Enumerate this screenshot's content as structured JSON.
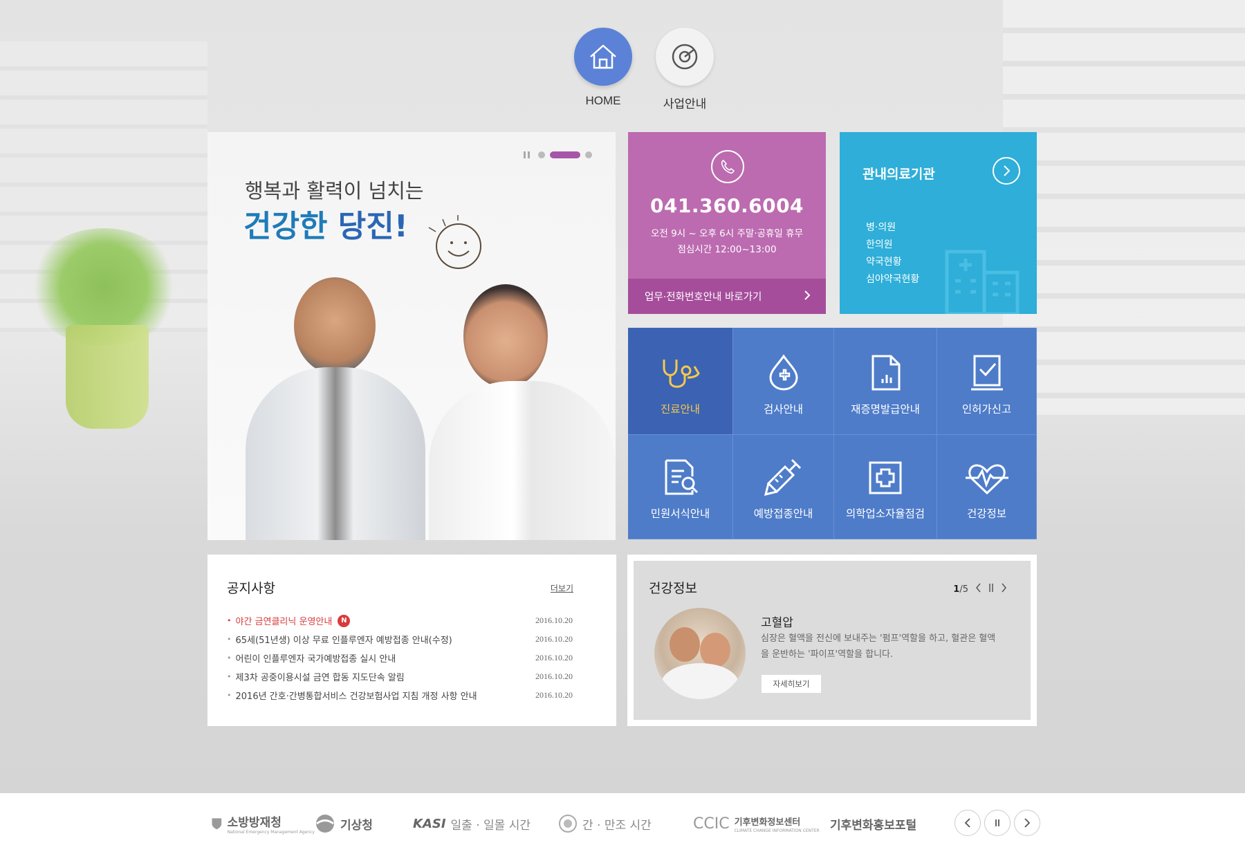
{
  "nav": {
    "home_label": "HOME",
    "business_label": "사업안내"
  },
  "hero": {
    "line1": "행복과 활력이 넘치는",
    "line2_a": "건강한",
    "line2_b": "당진!"
  },
  "phone": {
    "number": "041.360.6004",
    "hours": "오전 9시 ~ 오후 6시 주말·공휴일 휴무",
    "lunch": "점심시간 12:00~13:00",
    "link_label": "업무·전화번호안내 바로가기"
  },
  "medical": {
    "title": "관내의료기관",
    "items": [
      "병·의원",
      "한의원",
      "약국현황",
      "심야약국현황"
    ]
  },
  "services": [
    {
      "label": "진료안내",
      "icon": "stethoscope-icon"
    },
    {
      "label": "검사안내",
      "icon": "blood-drop-cross-icon"
    },
    {
      "label": "재증명발급안내",
      "icon": "document-chart-icon"
    },
    {
      "label": "인허가신고",
      "icon": "clipboard-check-icon"
    },
    {
      "label": "민원서식안내",
      "icon": "document-search-icon"
    },
    {
      "label": "예방접종안내",
      "icon": "syringe-icon"
    },
    {
      "label": "의학업소자율점검",
      "icon": "medical-box-icon"
    },
    {
      "label": "건강정보",
      "icon": "heart-pulse-icon"
    }
  ],
  "notice": {
    "title": "공지사항",
    "more_label": "더보기",
    "new_badge": "N",
    "items": [
      {
        "title": "야간 금연클리닉 운영안내",
        "date": "2016.10.20"
      },
      {
        "title": "65세(51년생) 이상 무료 인플루엔자 예방접종 안내(수정)",
        "date": "2016.10.20"
      },
      {
        "title": "어린이 인플루엔자 국가예방접종 실시 안내",
        "date": "2016.10.20"
      },
      {
        "title": "제3차 공중이용시설 금연 합동 지도단속 알림",
        "date": "2016.10.20"
      },
      {
        "title": "2016년 간호·간병통합서비스 건강보험사업 지침 개정 사항 안내",
        "date": "2016.10.20"
      }
    ]
  },
  "health": {
    "title": "건강정보",
    "page_current": "1",
    "page_total": "/5",
    "item_title": "고혈압",
    "item_desc": "심장은 혈액을 전신에 보내주는 '펌프'역할을 하고, 혈관은 혈액을 운반하는 '파이프'역할을 합니다.",
    "more_label": "자세히보기"
  },
  "footer": {
    "logos": [
      {
        "main": "소방방재청",
        "sub": "National Emergency Management Agency"
      },
      {
        "main": "기상청"
      },
      {
        "main": "KASI",
        "sub2": "일출 · 일몰 시간"
      },
      {
        "main": "간 · 만조 시간"
      },
      {
        "main": "CCIC",
        "sub2": "기후변화정보센터",
        "sub": "CLIMATE CHANGE INFORMATION CENTER"
      },
      {
        "main": "기후변화홍보포털"
      }
    ]
  },
  "colors": {
    "purple": "#bc6bb0",
    "cyan": "#2eaed8",
    "blue": "#4e7cc9",
    "accent_blue": "#5b82d6",
    "hot_red": "#d83b3b"
  }
}
